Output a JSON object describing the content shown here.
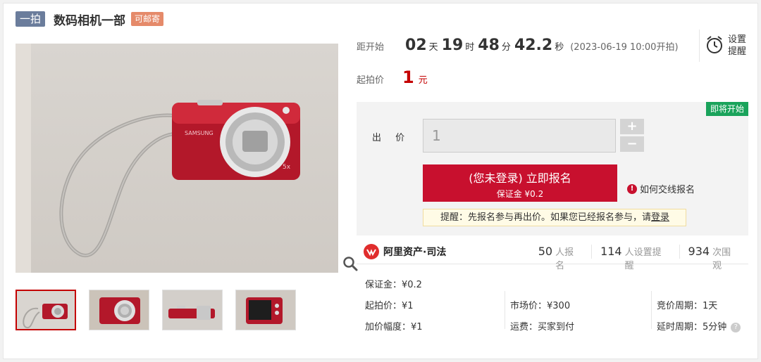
{
  "header": {
    "platform_tag": "一拍",
    "title": "数码相机一部",
    "shipping_tag": "可邮寄"
  },
  "countdown": {
    "label": "距开始",
    "days": "02",
    "days_unit": "天",
    "hours": "19",
    "hours_unit": "时",
    "minutes": "48",
    "minutes_unit": "分",
    "seconds": "42.2",
    "seconds_unit": "秒",
    "start_time": "(2023-06-19 10:00开拍)"
  },
  "remind": {
    "line1": "设置",
    "line2": "提醒"
  },
  "start_price": {
    "label": "起拍价",
    "value": "1",
    "unit": "元"
  },
  "bid": {
    "status_badge": "即将开始",
    "label": "出 价",
    "value": "1",
    "plus": "+",
    "minus": "−",
    "signup_main": "(您未登录) 立即报名",
    "signup_sub": "保证金 ¥0.2",
    "howto": "如何交线报名",
    "tip_prefix": "提醒：先报名参与再出价。如果您已经报名参与，请",
    "tip_link": "登录"
  },
  "stats": {
    "brand": "阿里资产·司法",
    "signups_num": "50",
    "signups_label": "人报名",
    "reminders_num": "114",
    "reminders_label": "人设置提醒",
    "views_num": "934",
    "views_label": "次围观"
  },
  "details": {
    "deposit": "保证金：¥0.2",
    "start_price": "起拍价：¥1",
    "increment": "加价幅度：¥1",
    "market_price": "市场价：¥300",
    "shipping": "运费：买家到付",
    "bid_cycle": "竞价周期：1天",
    "delay_cycle": "延时周期：5分钟"
  },
  "colors": {
    "accent_red": "#c8102e",
    "badge_green": "#1aa35b",
    "tag_blue": "#6b7d9c"
  }
}
